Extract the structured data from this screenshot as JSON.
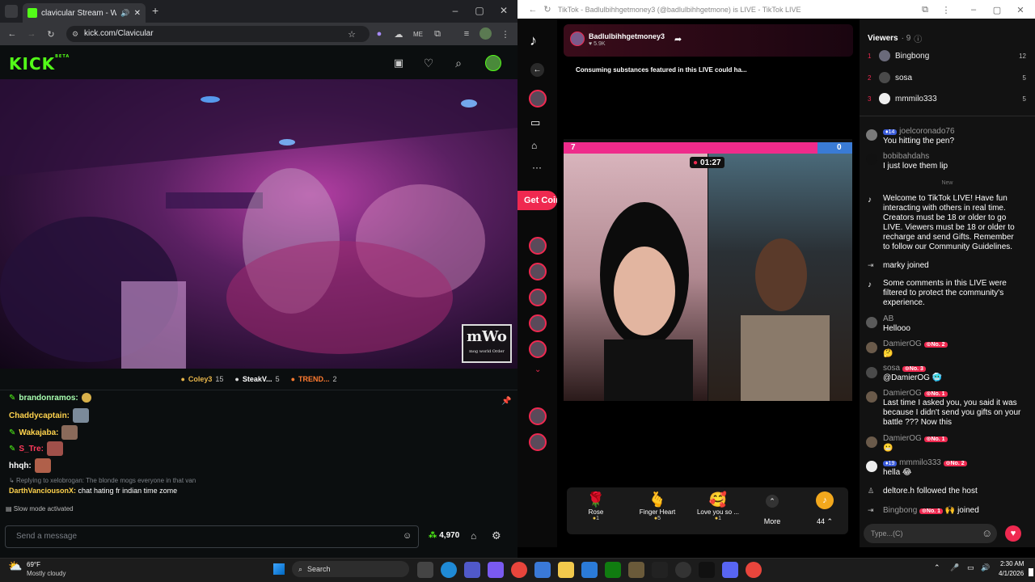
{
  "left_browser": {
    "tab_title": "clavicular Stream - Watch L",
    "url": "kick.com/Clavicular",
    "window_controls": [
      "–",
      "▢",
      "✕"
    ]
  },
  "kick": {
    "logo": "KICK",
    "logo_badge": "BETA",
    "watermark_main": "mWo",
    "watermark_sub": "mog world Order",
    "top_gifters": [
      {
        "name": "Coley3",
        "count": "15"
      },
      {
        "name": "SteakV...",
        "count": "5"
      },
      {
        "name": "TREND...",
        "count": "2"
      }
    ],
    "chat": [
      {
        "user": "brandonramos:",
        "color": "#a8ffb0",
        "text": ""
      },
      {
        "user": "Chaddycaptain:",
        "color": "#ffd34d",
        "text": ""
      },
      {
        "user": "Wakajaba:",
        "color": "#ffd34d",
        "text": ""
      },
      {
        "user": "S_Tre:",
        "color": "#ff3b5c",
        "text": ""
      },
      {
        "user": "hhqh:",
        "color": "#ffffff",
        "text": ""
      }
    ],
    "reply_context": "Replying to xelobrogan: The blonde mogs everyone in that van",
    "reply_user": "DarthVanciousonX:",
    "reply_text": "chat hating fr indian time zome",
    "slow_mode": "Slow mode activated",
    "input_placeholder": "Send a message",
    "points": "4,970"
  },
  "right_browser": {
    "title": "TikTok - Badlulbihhgetmoney3 (@badlulbihhgetmone) is LIVE - TikTok LIVE"
  },
  "tiktok": {
    "host_name": "Badlulbihhgetmoney3",
    "host_likes": "5.9K",
    "warning": "Consuming substances featured in this LIVE could ha...",
    "get_coins": "Get Coins",
    "battle_left_score": "7",
    "battle_right_score": "0",
    "battle_timer": "01:27",
    "gifts": [
      {
        "name": "Rose",
        "price": "1",
        "emoji": "🌹"
      },
      {
        "name": "Finger Heart",
        "price": "5",
        "emoji": "🫰"
      },
      {
        "name": "Love you so ...",
        "price": "1",
        "emoji": "🥰"
      }
    ],
    "more_label": "More",
    "coin_count": "44",
    "viewers_label": "Viewers",
    "viewers_count": "9",
    "top_viewers": [
      {
        "rank": "1",
        "name": "Bingbong",
        "score": "12"
      },
      {
        "rank": "2",
        "name": "sosa",
        "score": "5"
      },
      {
        "rank": "3",
        "name": "mmmilo333",
        "score": "5"
      }
    ],
    "chat_header_user": "joelcoronado76",
    "chat_header_level": "14",
    "chat_header_text": "You hitting the pen?",
    "msg2_user": "bobibahdahs",
    "msg2_text": "I just love them lip",
    "new_label": "New",
    "welcome_text": "Welcome to TikTok LIVE! Have fun interacting with others in real time. Creators must be 18 or older to go LIVE. Viewers must be 18 or older to recharge and send Gifts. Remember to follow our Community Guidelines.",
    "joined1_user": "marky",
    "joined_label": "joined",
    "filter_text": "Some comments in this LIVE were filtered to protect the community's experience.",
    "ab_user": "AB",
    "ab_text": "Hellooo",
    "d1_user": "DamierOG",
    "d1_badge": "No. 2",
    "sosa_user": "sosa",
    "sosa_badge": "No. 3",
    "sosa_text": "@DamierOG",
    "d2_user": "DamierOG",
    "d2_badge": "No. 1",
    "d2_text": "Last time I asked you, you said it was because I didn't send you gifts on your battle ??? Now this",
    "d3_user": "DamierOG",
    "d3_badge": "No. 1",
    "milo_level": "19",
    "milo_user": "mmmilo333",
    "milo_badge": "No. 2",
    "milo_text": "hella",
    "deltore_user": "deltore.h",
    "deltore_text": "followed the host",
    "bb_user": "Bingbong",
    "bb_badge": "No. 1",
    "input_placeholder": "Type...(C)"
  },
  "taskbar": {
    "temp": "69°F",
    "weather": "Mostly cloudy",
    "search_label": "Search",
    "time": "2:30 AM",
    "date": "4/1/2026"
  }
}
